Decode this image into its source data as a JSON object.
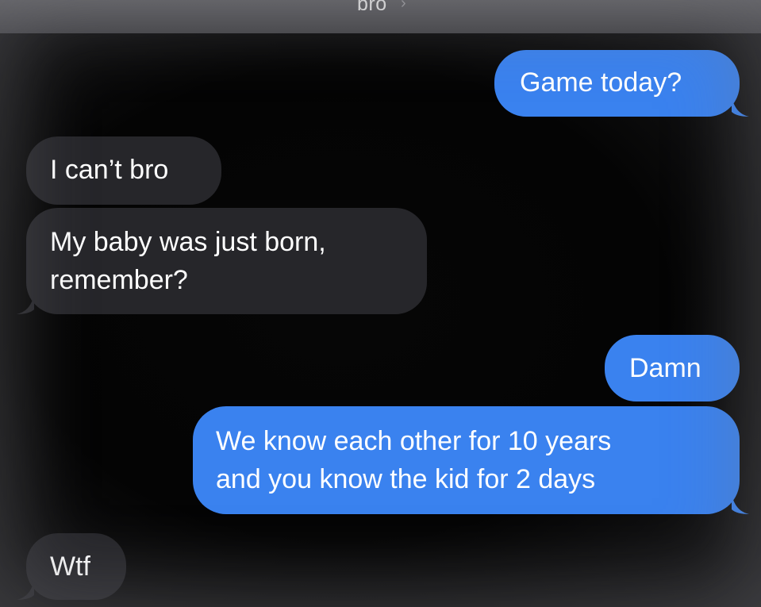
{
  "header": {
    "contact_name": "bro",
    "chevron": "›"
  },
  "messages": [
    {
      "direction": "sent",
      "text": "Game today?"
    },
    {
      "direction": "received",
      "text": "I can’t bro"
    },
    {
      "direction": "received",
      "lines": [
        "My baby was just born,",
        "remember?"
      ]
    },
    {
      "direction": "sent",
      "text": "Damn"
    },
    {
      "direction": "sent",
      "lines": [
        "We know each other for 10 years",
        "and you know the kid for 2 days"
      ]
    },
    {
      "direction": "received",
      "text": "Wtf"
    }
  ],
  "colors": {
    "sent_bubble": "#3a82ef",
    "received_bubble": "#26262a",
    "background": "#000000"
  }
}
